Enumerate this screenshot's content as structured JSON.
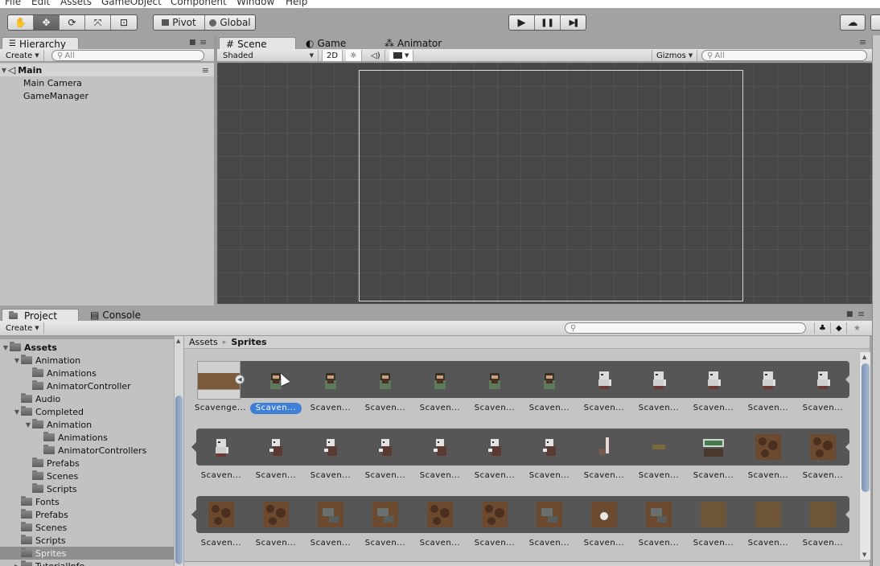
{
  "menu": [
    "File",
    "Edit",
    "Assets",
    "GameObject",
    "Component",
    "Window",
    "Help"
  ],
  "toolbar": {
    "tools": [
      {
        "name": "hand-tool",
        "glyph": "✋",
        "active": false
      },
      {
        "name": "move-tool",
        "glyph": "✥",
        "active": true
      },
      {
        "name": "rotate-tool",
        "glyph": "⟳",
        "active": false
      },
      {
        "name": "scale-tool",
        "glyph": "⤧",
        "active": false
      },
      {
        "name": "rect-tool",
        "glyph": "⊡",
        "active": false
      }
    ],
    "pivot_label": "Pivot",
    "global_label": "Global",
    "play_glyph": "▶",
    "pause_glyph": "❚❚",
    "step_glyph": "▶❚",
    "cloud_glyph": "☁"
  },
  "hierarchy": {
    "tab_label": "Hierarchy",
    "create_label": "Create",
    "search_placeholder": "All",
    "scene_name": "Main",
    "items": [
      "Main Camera",
      "GameManager"
    ]
  },
  "scene": {
    "tabs": [
      {
        "label": "Scene",
        "glyph": "#"
      },
      {
        "label": "Game",
        "glyph": "◐"
      },
      {
        "label": "Animator",
        "glyph": "⁂"
      }
    ],
    "shading_mode": "Shaded",
    "mode_2d_label": "2D",
    "light_glyph": "☼",
    "audio_glyph": "🔈",
    "effects_glyph": "▭",
    "gizmos_label": "Gizmos",
    "search_placeholder": "All"
  },
  "project": {
    "tabs": [
      {
        "label": "Project",
        "glyph": "▭"
      },
      {
        "label": "Console",
        "glyph": "▤"
      }
    ],
    "create_label": "Create",
    "tree": [
      {
        "label": "Assets",
        "depth": 0,
        "expanded": true,
        "bold": true
      },
      {
        "label": "Animation",
        "depth": 1,
        "expanded": true
      },
      {
        "label": "Animations",
        "depth": 2
      },
      {
        "label": "AnimatorController",
        "depth": 2
      },
      {
        "label": "Audio",
        "depth": 1
      },
      {
        "label": "Completed",
        "depth": 1,
        "expanded": true
      },
      {
        "label": "Animation",
        "depth": 2,
        "expanded": true
      },
      {
        "label": "Animations",
        "depth": 3
      },
      {
        "label": "AnimatorControllers",
        "depth": 3
      },
      {
        "label": "Prefabs",
        "depth": 2
      },
      {
        "label": "Scenes",
        "depth": 2
      },
      {
        "label": "Scripts",
        "depth": 2
      },
      {
        "label": "Fonts",
        "depth": 1
      },
      {
        "label": "Prefabs",
        "depth": 1
      },
      {
        "label": "Scenes",
        "depth": 1
      },
      {
        "label": "Scripts",
        "depth": 1
      },
      {
        "label": "Sprites",
        "depth": 1,
        "selected": true
      },
      {
        "label": "TutorialInfo",
        "depth": 1,
        "collapsed": true
      }
    ],
    "breadcrumb": [
      "Assets",
      "Sprites"
    ],
    "breadcrumb_sep": "▸",
    "parent_sheet_label": "Scavenge...",
    "rows": [
      {
        "kinds": [
          "player",
          "player",
          "player",
          "player",
          "player",
          "player",
          "zombie",
          "zombie",
          "zombie",
          "zombie",
          "zombie"
        ],
        "labels": [
          "Scaven...",
          "Scaven...",
          "Scaven...",
          "Scaven...",
          "Scaven...",
          "Scaven...",
          "Scaven...",
          "Scaven...",
          "Scaven...",
          "Scaven...",
          "Scaven..."
        ],
        "selected_index": 0
      },
      {
        "kinds": [
          "zombie",
          "vampire",
          "vampire",
          "vampire",
          "vampire",
          "vampire",
          "vampire",
          "soda",
          "food",
          "exit",
          "dirt",
          "dirt"
        ],
        "labels": [
          "Scaven...",
          "Scaven...",
          "Scaven...",
          "Scaven...",
          "Scaven...",
          "Scaven...",
          "Scaven...",
          "Scaven...",
          "Scaven...",
          "Scaven...",
          "Scaven...",
          "Scaven..."
        ]
      },
      {
        "kinds": [
          "dirt",
          "dirt",
          "rock",
          "rock",
          "dirt",
          "dirt",
          "rock",
          "skull",
          "rock",
          "floor",
          "floor",
          "floor"
        ],
        "labels": [
          "Scaven...",
          "Scaven...",
          "Scaven...",
          "Scaven...",
          "Scaven...",
          "Scaven...",
          "Scaven...",
          "Scaven...",
          "Scaven...",
          "Scaven...",
          "Scaven...",
          "Scaven..."
        ]
      }
    ]
  },
  "colors": {
    "selection": "#3f7fd6",
    "panel_bg": "#c2c2c2",
    "scene_bg": "#474747",
    "strip_bg": "#565656"
  }
}
